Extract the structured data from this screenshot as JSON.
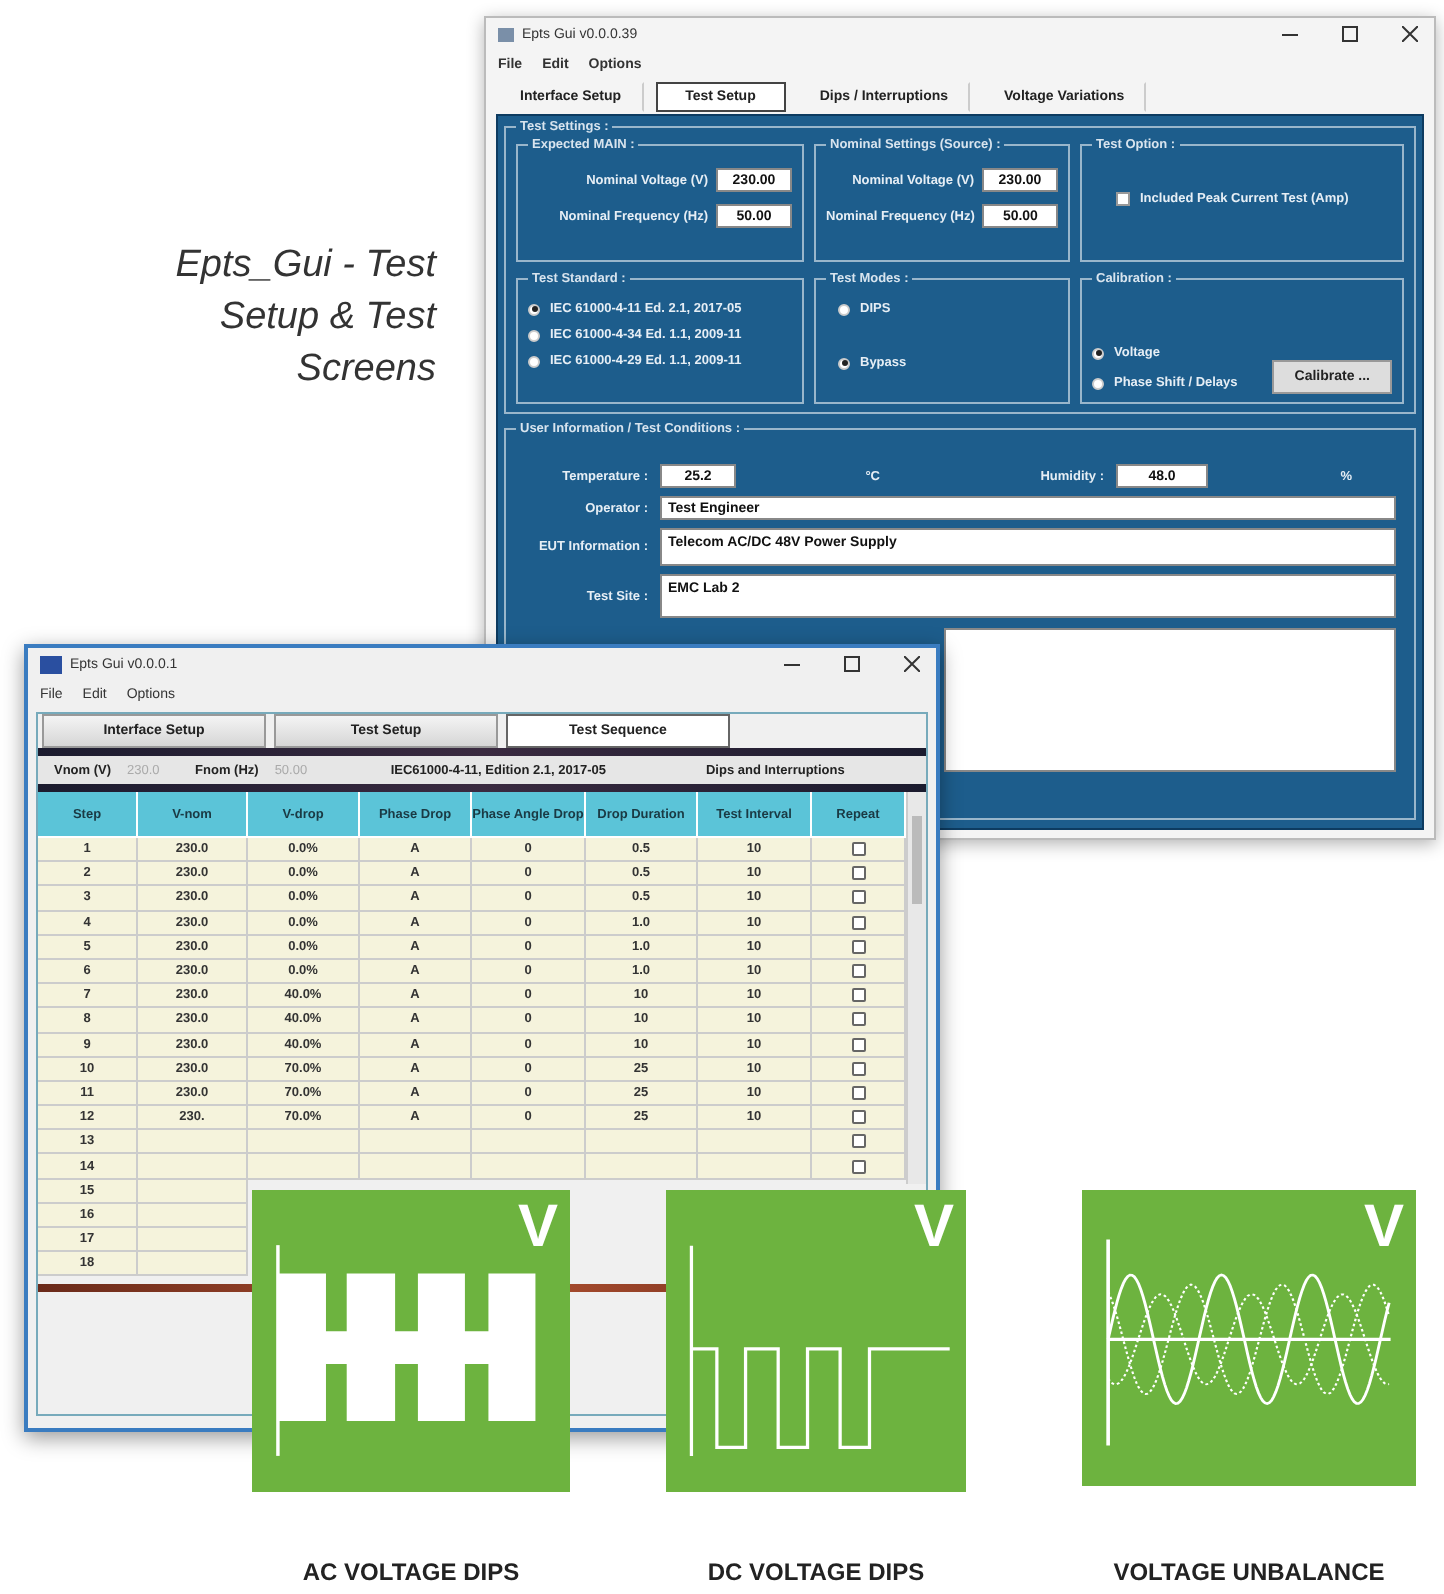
{
  "heading": "Epts_Gui - Test Setup & Test Screens",
  "setup_window": {
    "title": "Epts Gui v0.0.0.39",
    "menu": [
      "File",
      "Edit",
      "Options"
    ],
    "tabs": [
      {
        "label": "Interface Setup",
        "selected": false
      },
      {
        "label": "Test Setup",
        "selected": true
      },
      {
        "label": "Dips / Interruptions",
        "selected": false
      },
      {
        "label": "Voltage Variations",
        "selected": false
      }
    ],
    "test_settings": {
      "legend": "Test Settings :",
      "expected_main": {
        "legend": "Expected MAIN :",
        "fields": [
          {
            "label": "Nominal Voltage (V)",
            "value": "230.00"
          },
          {
            "label": "Nominal Frequency (Hz)",
            "value": "50.00"
          }
        ]
      },
      "nominal_settings": {
        "legend": "Nominal Settings (Source) :",
        "fields": [
          {
            "label": "Nominal Voltage (V)",
            "value": "230.00"
          },
          {
            "label": "Nominal Frequency (Hz)",
            "value": "50.00"
          }
        ]
      },
      "test_option": {
        "legend": "Test Option :",
        "options": [
          {
            "label": "Included Peak Current Test (Amp)",
            "checked": false
          }
        ]
      },
      "test_standard": {
        "legend": "Test Standard :",
        "options": [
          {
            "label": "IEC 61000-4-11 Ed. 2.1, 2017-05",
            "selected": true
          },
          {
            "label": "IEC 61000-4-34 Ed. 1.1, 2009-11",
            "selected": false
          },
          {
            "label": "IEC 61000-4-29 Ed. 1.1, 2009-11",
            "selected": false
          }
        ]
      },
      "test_modes": {
        "legend": "Test Modes :",
        "options": [
          {
            "label": "DIPS",
            "selected": false
          },
          {
            "label": "Bypass",
            "selected": true
          }
        ]
      },
      "calibration": {
        "legend": "Calibration :",
        "options": [
          {
            "label": "Voltage",
            "selected": true
          },
          {
            "label": "Phase Shift / Delays",
            "selected": false
          }
        ],
        "button": "Calibrate ..."
      }
    },
    "user_information": {
      "legend": "User Information / Test Conditions :",
      "temperature": {
        "label": "Temperature :",
        "value": "25.2",
        "unit": "°C"
      },
      "humidity": {
        "label": "Humidity :",
        "value": "48.0",
        "unit": "%"
      },
      "fields": [
        {
          "label": "Operator :",
          "value": "Test Engineer"
        },
        {
          "label": "EUT Information :",
          "value": "Telecom AC/DC 48V Power Supply"
        },
        {
          "label": "Test Site :",
          "value": "EMC Lab 2"
        }
      ]
    }
  },
  "sequence_window": {
    "title": "Epts Gui v0.0.0.1",
    "menu": [
      "File",
      "Edit",
      "Options"
    ],
    "tabs": [
      {
        "label": "Interface Setup",
        "selected": false
      },
      {
        "label": "Test Setup",
        "selected": false
      },
      {
        "label": "Test Sequence",
        "selected": true
      }
    ],
    "info_bar": {
      "vnom_label": "Vnom (V)",
      "vnom_value": "230.0",
      "fnom_label": "Fnom (Hz)",
      "fnom_value": "50.00",
      "standard": "IEC61000-4-11, Edition 2.1, 2017-05",
      "test_type": "Dips and Interruptions"
    },
    "table": {
      "columns": [
        "Step",
        "V-nom",
        "V-drop",
        "Phase Drop",
        "Phase Angle Drop",
        "Drop Duration",
        "Test Interval",
        "Repeat"
      ],
      "rows": [
        {
          "cells": [
            "1",
            "230.0",
            "0.0%",
            "A",
            "0",
            "0.5",
            "10"
          ],
          "repeat": false
        },
        {
          "cells": [
            "2",
            "230.0",
            "0.0%",
            "A",
            "0",
            "0.5",
            "10"
          ],
          "repeat": false
        },
        {
          "cells": [
            "3",
            "230.0",
            "0.0%",
            "A",
            "0",
            "0.5",
            "10"
          ],
          "repeat": false
        },
        {
          "cells": [
            "4",
            "230.0",
            "0.0%",
            "A",
            "0",
            "1.0",
            "10"
          ],
          "repeat": false
        },
        {
          "cells": [
            "5",
            "230.0",
            "0.0%",
            "A",
            "0",
            "1.0",
            "10"
          ],
          "repeat": false
        },
        {
          "cells": [
            "6",
            "230.0",
            "0.0%",
            "A",
            "0",
            "1.0",
            "10"
          ],
          "repeat": false
        },
        {
          "cells": [
            "7",
            "230.0",
            "40.0%",
            "A",
            "0",
            "10",
            "10"
          ],
          "repeat": false
        },
        {
          "cells": [
            "8",
            "230.0",
            "40.0%",
            "A",
            "0",
            "10",
            "10"
          ],
          "repeat": false
        },
        {
          "cells": [
            "9",
            "230.0",
            "40.0%",
            "A",
            "0",
            "10",
            "10"
          ],
          "repeat": false
        },
        {
          "cells": [
            "10",
            "230.0",
            "70.0%",
            "A",
            "0",
            "25",
            "10"
          ],
          "repeat": false
        },
        {
          "cells": [
            "11",
            "230.0",
            "70.0%",
            "A",
            "0",
            "25",
            "10"
          ],
          "repeat": false
        },
        {
          "cells": [
            "12",
            "230.",
            "70.0%",
            "A",
            "0",
            "25",
            "10"
          ],
          "repeat": false
        },
        {
          "cells": [
            "13"
          ],
          "repeat": false
        },
        {
          "cells": [
            "14"
          ],
          "repeat": false
        },
        {
          "cells": [
            "15"
          ]
        },
        {
          "cells": [
            "16"
          ]
        },
        {
          "cells": [
            "17"
          ]
        },
        {
          "cells": [
            "18"
          ]
        }
      ]
    }
  },
  "tiles": [
    {
      "kind": "ac_dips",
      "symbol": "V",
      "caption": "AC VOLTAGE DIPS"
    },
    {
      "kind": "dc_dips",
      "symbol": "V",
      "caption": "DC VOLTAGE DIPS"
    },
    {
      "kind": "unbalance",
      "symbol": "V",
      "caption": "VOLTAGE UNBALANCE"
    }
  ]
}
